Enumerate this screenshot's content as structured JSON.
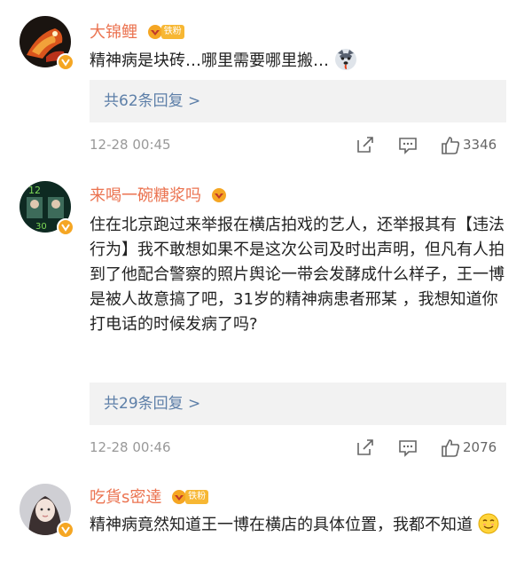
{
  "comments": [
    {
      "username": "大锦鲤",
      "fan_tag": "铁粉",
      "text": "精神病是块砖…哪里需要哪里搬…",
      "replies_label": "共62条回复 >",
      "time": "12-28 00:45",
      "likes": "3346"
    },
    {
      "username": "来喝一碗糖浆吗",
      "text": "住在北京跑过来举报在横店拍戏的艺人，还举报其有【违法行为】我不敢想如果不是这次公司及时出声明，但凡有人拍到了他配合警察的照片舆论一带会发酵成什么样子，王一博是被人故意搞了吧，31岁的精神病患者邢某 ，我想知道你打电话的时候发病了吗?",
      "replies_label": "共29条回复 >",
      "time": "12-28 00:46",
      "likes": "2076"
    },
    {
      "username": "吃貨s密達",
      "fan_tag": "铁粉",
      "text": "精神病竟然知道王一博在横店的具体位置，我都不知道"
    }
  ],
  "colors": {
    "username": "#eb7350",
    "link": "#5d7fa8",
    "reply_bg": "#f2f2f2",
    "meta": "#999999",
    "badge": "#f7b733"
  }
}
